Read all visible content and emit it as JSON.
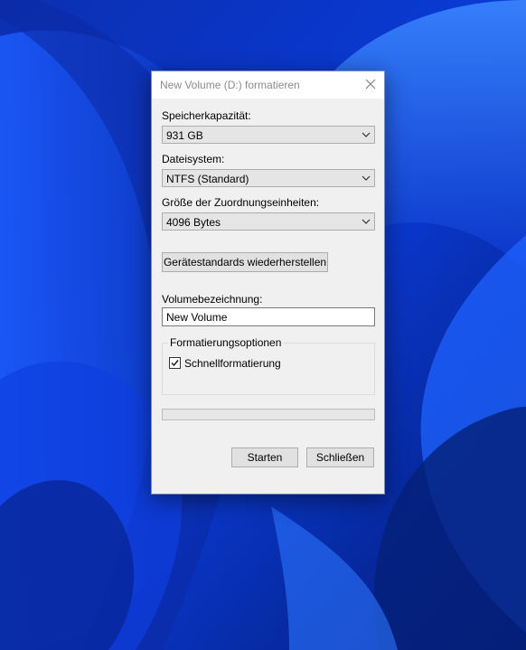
{
  "dialog": {
    "title": "New Volume (D:) formatieren",
    "capacity": {
      "label": "Speicherkapazität:",
      "value": "931 GB"
    },
    "filesystem": {
      "label": "Dateisystem:",
      "value": "NTFS (Standard)"
    },
    "allocation": {
      "label": "Größe der Zuordnungseinheiten:",
      "value": "4096 Bytes"
    },
    "restore_defaults_label": "Gerätestandards wiederherstellen",
    "volume_label": {
      "label": "Volumebezeichnung:",
      "value": "New Volume"
    },
    "options": {
      "title": "Formatierungsoptionen",
      "quick_format_label": "Schnellformatierung",
      "quick_format_checked": true
    },
    "progress_fraction": 0,
    "start_label": "Starten",
    "close_label": "Schließen",
    "close_icon": "close-icon",
    "dropdown_icon": "chevron-down-icon"
  },
  "colors": {
    "wallpaper_dark": "#041a73",
    "wallpaper_mid": "#0a3bd6",
    "wallpaper_light": "#2f79ff",
    "dialog_bg": "#f0f0f0",
    "title_text": "#8c8c8c"
  }
}
